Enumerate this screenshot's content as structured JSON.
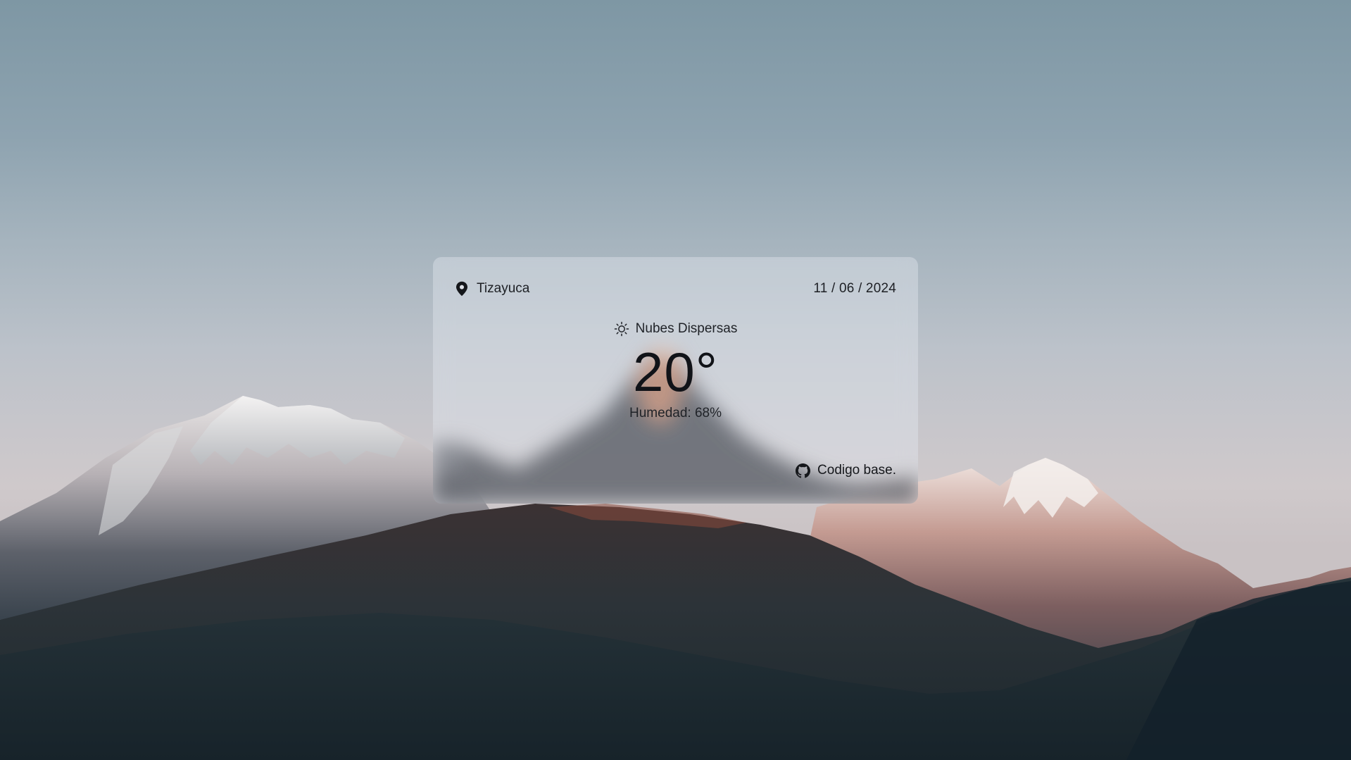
{
  "location": {
    "icon": "map-pin-icon",
    "city": "Tizayuca"
  },
  "date": "11 / 06 / 2024",
  "weather": {
    "icon": "sun-icon",
    "description": "Nubes Dispersas",
    "temperature": "20°",
    "humidity_label": "Humedad: 68%"
  },
  "footer": {
    "icon": "github-icon",
    "link_label": "Codigo base."
  }
}
